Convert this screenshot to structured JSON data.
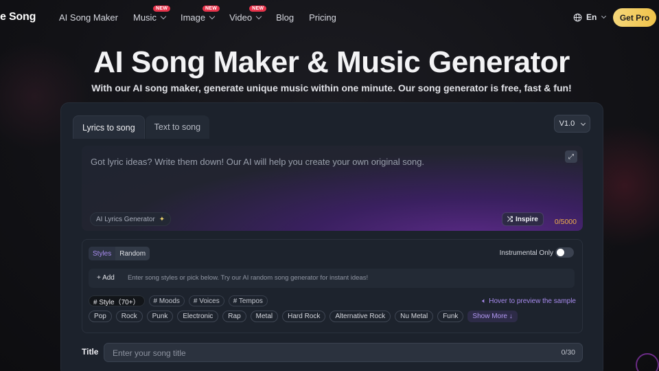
{
  "header": {
    "brand": "e Song",
    "menu": [
      {
        "label": "AI Song Maker",
        "dropdown": false,
        "badge": ""
      },
      {
        "label": "Music",
        "dropdown": true,
        "badge": "NEW"
      },
      {
        "label": "Image",
        "dropdown": true,
        "badge": "NEW"
      },
      {
        "label": "Video",
        "dropdown": true,
        "badge": "NEW"
      },
      {
        "label": "Blog",
        "dropdown": false,
        "badge": ""
      },
      {
        "label": "Pricing",
        "dropdown": false,
        "badge": ""
      }
    ],
    "language": "En",
    "cta": "Get Pro"
  },
  "hero": {
    "title": "AI Song Maker & Music Generator",
    "subtitle": "With our AI song maker, generate unique music within one minute. Our song generator is free, fast & fun!"
  },
  "generator": {
    "tabs": [
      "Lyrics to song",
      "Text to song"
    ],
    "active_tab": 0,
    "version": "V1.0",
    "lyrics": {
      "placeholder": "Got lyric ideas? Write them down! Our AI will help you create your own original song.",
      "ai_generator": "AI Lyrics Generator",
      "inspire": "Inspire",
      "count": "0/5000"
    },
    "styles": {
      "segments": [
        "Styles",
        "Random"
      ],
      "instrumental_label": "Instrumental Only",
      "instrumental_on": false,
      "add_label": "+ Add",
      "add_placeholder": "Enter song styles or pick below. Try our AI random song generator for instant ideas!",
      "categories": [
        "# Style（70+）",
        "# Moods",
        "# Voices",
        "# Tempos"
      ],
      "hover_note": "Hover to preview the sample",
      "chips": [
        "Pop",
        "Rock",
        "Punk",
        "Electronic",
        "Rap",
        "Metal",
        "Hard Rock",
        "Alternative Rock",
        "Nu Metal",
        "Funk"
      ],
      "show_more": "Show More ↓"
    },
    "title_field": {
      "label": "Title",
      "placeholder": "Enter your song title",
      "count": "0/30"
    }
  },
  "colors": {
    "accent_purple": "#a98cf0",
    "cta_gold": "#f0c34a",
    "badge_red": "#e8344c",
    "counter_orange": "#f0b04a"
  }
}
